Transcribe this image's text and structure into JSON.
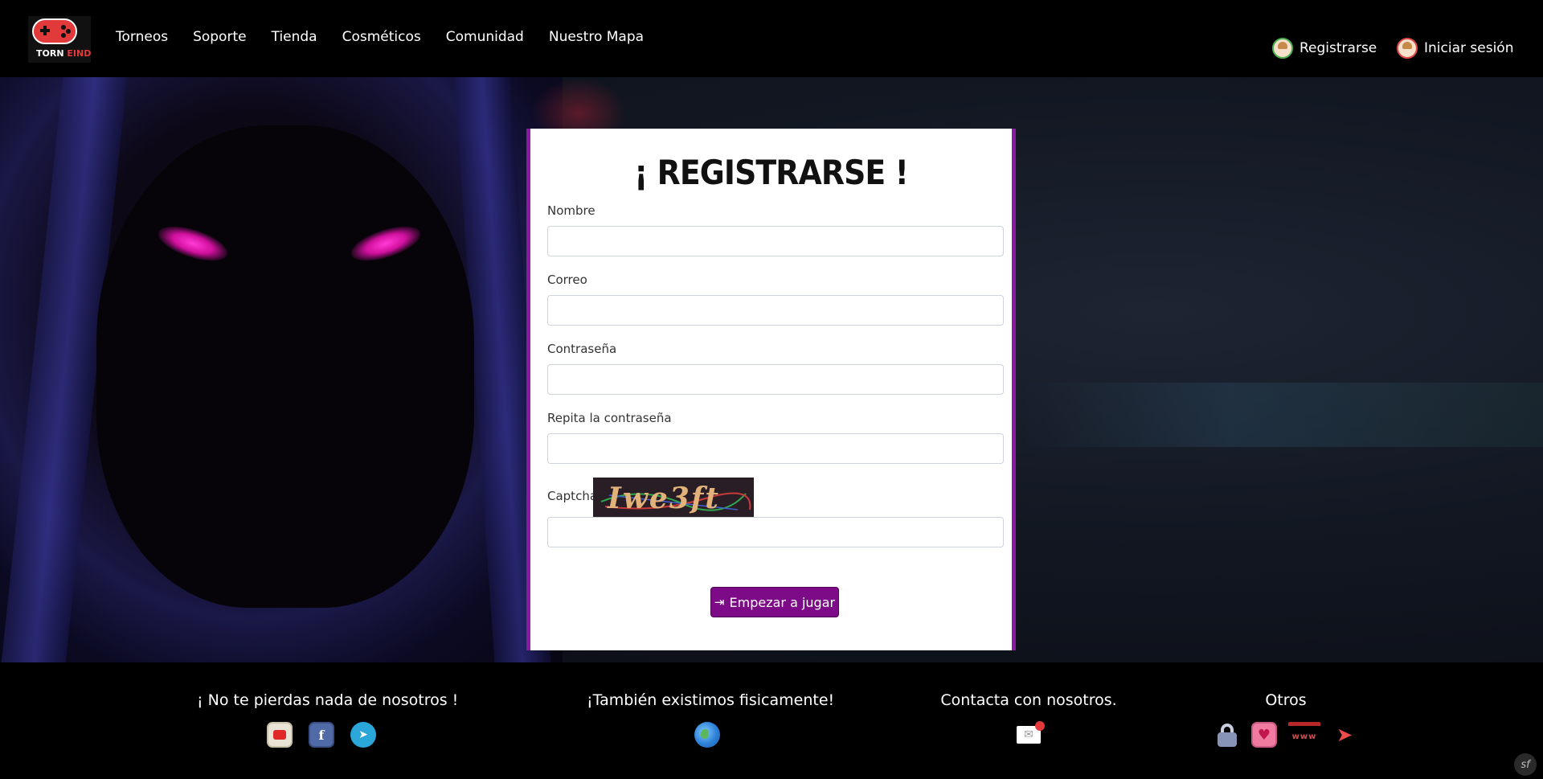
{
  "brand": {
    "name_part1": "TORN",
    "name_part2": "EIND"
  },
  "nav": {
    "links": [
      "Torneos",
      "Soporte",
      "Tienda",
      "Cosméticos",
      "Comunidad",
      "Nuestro Mapa"
    ],
    "register": "Registrarse",
    "login": "Iniciar sesión"
  },
  "form": {
    "title": "¡ REGISTRARSE !",
    "fields": {
      "name": {
        "label": "Nombre",
        "value": ""
      },
      "email": {
        "label": "Correo",
        "value": ""
      },
      "password": {
        "label": "Contraseña",
        "value": ""
      },
      "password_repeat": {
        "label": "Repita la contraseña",
        "value": ""
      },
      "captcha": {
        "label": "Captcha",
        "image_text": "Iwe3ft",
        "value": ""
      }
    },
    "submit": "Empezar a jugar"
  },
  "footer": {
    "social": {
      "heading": "¡ No te pierdas nada de nosotros !",
      "icons": [
        "youtube-icon",
        "facebook-icon",
        "telegram-icon"
      ]
    },
    "physical": {
      "heading": "¡También existimos fisicamente!",
      "icons": [
        "globe-icon"
      ]
    },
    "contact": {
      "heading": "Contacta con nosotros.",
      "icons": [
        "mail-icon"
      ]
    },
    "other": {
      "heading": "Otros",
      "icons": [
        "lock-icon",
        "heart-icon",
        "www-icon",
        "paper-plane-icon"
      ]
    }
  },
  "colors": {
    "accent": "#7d0a86",
    "card_border": "#8a1aa0",
    "brand_red": "#e23a3a"
  }
}
